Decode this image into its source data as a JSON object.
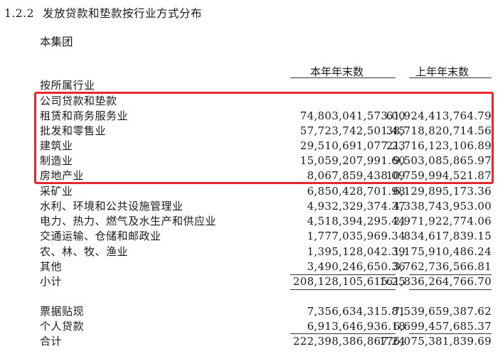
{
  "heading": {
    "number": "1.2.2",
    "title": "发放贷款和垫款按行业方式分布"
  },
  "group": "本集团",
  "columns": {
    "current": "本年年末数",
    "previous": "上年年末数"
  },
  "section_label": "按所属行业",
  "subsection_label": "公司贷款和垫款",
  "rows": [
    {
      "label": "租赁和商务服务业",
      "current": "74,803,041,573.00",
      "previous": "61,924,413,764.79"
    },
    {
      "label": "批发和零售业",
      "current": "57,723,742,501.45",
      "previous": "38,718,820,714.56"
    },
    {
      "label": "建筑业",
      "current": "29,510,691,077.23",
      "previous": "21,716,123,106.89"
    },
    {
      "label": "制造业",
      "current": "15,059,207,991.60",
      "previous": "9,503,085,865.97"
    },
    {
      "label": "房地产业",
      "current": "8,067,859,438.09",
      "previous": "10,759,994,521.87"
    },
    {
      "label": "采矿业",
      "current": "6,850,428,701.98",
      "previous": "6,129,895,173.36"
    },
    {
      "label": "水利、环境和公共设施管理业",
      "current": "4,932,329,374.37",
      "previous": "4,338,743,953.00"
    },
    {
      "label": "电力、热力、燃气及水生产和供应业",
      "current": "4,518,394,295.44",
      "previous": "2,971,922,774.06"
    },
    {
      "label": "交通运输、仓储和邮政业",
      "current": "1,777,035,969.34",
      "previous": "834,617,839.15"
    },
    {
      "label": "农、林、牧、渔业",
      "current": "1,395,128,042.39",
      "previous": "1,175,910,486.24"
    },
    {
      "label": "其他",
      "current": "3,490,246,650.36",
      "previous": "3,762,736,566.81"
    }
  ],
  "subtotal": {
    "label": "小计",
    "current": "208,128,105,615.25",
    "previous": "161,836,264,766.70"
  },
  "other_rows": [
    {
      "label": "票据贴现",
      "current": "7,356,634,315.81",
      "previous": "7,539,659,387.62"
    },
    {
      "label": "个人贷款",
      "current": "6,913,646,936.18",
      "previous": "6,699,457,685.37"
    }
  ],
  "total": {
    "label": "合计",
    "current": "222,398,386,867.24",
    "previous": "176,075,381,839.69"
  },
  "colors": {
    "highlight_border": "#e8262d",
    "text": "#1a1a1a"
  }
}
